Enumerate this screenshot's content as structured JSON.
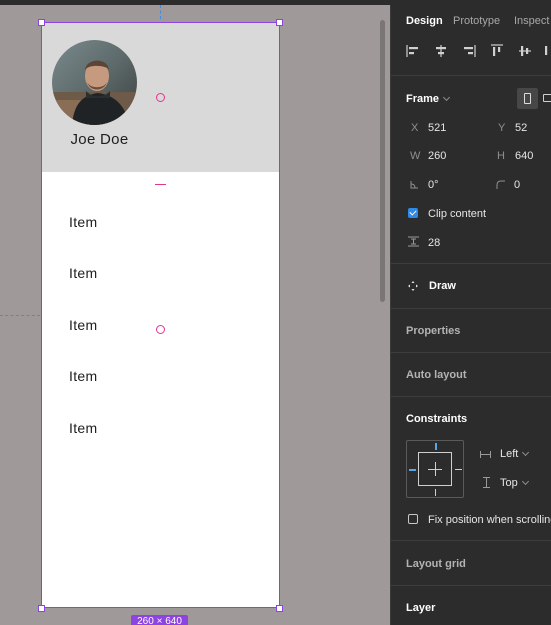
{
  "canvas": {
    "profile_name": "Joe Doe",
    "items": [
      "Item",
      "Item",
      "Item",
      "Item",
      "Item"
    ],
    "size_badge": "260 × 640"
  },
  "panel": {
    "tabs": [
      {
        "label": "Design",
        "active": true
      },
      {
        "label": "Prototype",
        "active": false
      },
      {
        "label": "Inspect",
        "active": false
      }
    ],
    "frame_section": {
      "title": "Frame",
      "x_label": "X",
      "x_value": "521",
      "y_label": "Y",
      "y_value": "52",
      "w_label": "W",
      "w_value": "260",
      "h_label": "H",
      "h_value": "640",
      "rotation_value": "0°",
      "radius_value": "0",
      "clip_label": "Clip content",
      "clip_checked": true,
      "spacing_value": "28"
    },
    "draw_label": "Draw",
    "properties_title": "Properties",
    "auto_layout_title": "Auto layout",
    "constraints": {
      "title": "Constraints",
      "horizontal": "Left",
      "vertical": "Top",
      "fix_position_label": "Fix position when scrolling",
      "fix_position_checked": false
    },
    "layout_grid_title": "Layout grid",
    "layer_title": "Layer"
  },
  "colors": {
    "canvas_bg": "#9f9a99",
    "panel_bg": "#2c2c2c",
    "selection": "#8e44e0",
    "accent_blue": "#2d8ae6",
    "smart_guide": "#e0368f",
    "header_gray": "#d9d9d9"
  }
}
